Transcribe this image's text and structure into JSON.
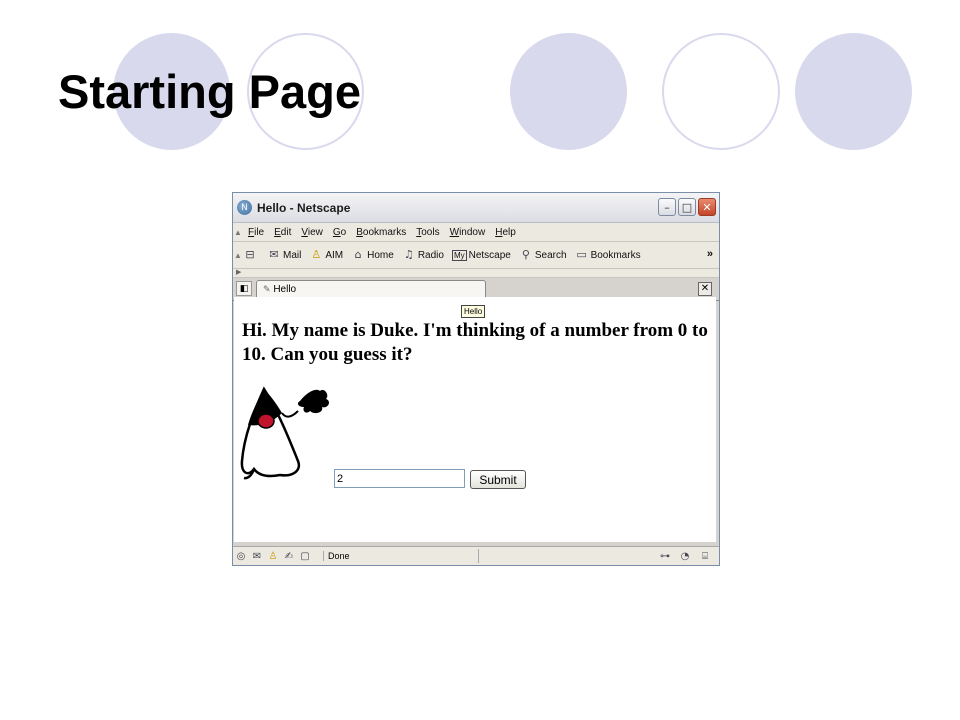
{
  "slide": {
    "title": "Starting Page"
  },
  "window": {
    "title": "Hello - Netscape",
    "controls": {
      "minimize": "–",
      "maximize": "□",
      "close": "✕"
    }
  },
  "menubar": {
    "items": [
      {
        "label_u": "F",
        "label_rest": "ile"
      },
      {
        "label_u": "E",
        "label_rest": "dit"
      },
      {
        "label_u": "V",
        "label_rest": "iew"
      },
      {
        "label_u": "G",
        "label_rest": "o"
      },
      {
        "label_u": "B",
        "label_rest": "ookmarks"
      },
      {
        "label_u": "T",
        "label_rest": "ools"
      },
      {
        "label_u": "W",
        "label_rest": "indow"
      },
      {
        "label_u": "H",
        "label_rest": "elp"
      }
    ]
  },
  "toolbar": {
    "mail": "Mail",
    "aim": "AIM",
    "home": "Home",
    "radio": "Radio",
    "my": "My",
    "netscape": "Netscape",
    "search": "Search",
    "bookmarks": "Bookmarks",
    "more": "»"
  },
  "tabs": {
    "active_label": "Hello",
    "close": "✕"
  },
  "page": {
    "tooltip": "Hello",
    "heading": "Hi. My name is Duke. I'm thinking of a number from 0 to 10. Can you guess it?",
    "input_value": "2",
    "submit_label": "Submit"
  },
  "statusbar": {
    "text": "Done"
  },
  "colors": {
    "deco": "#d9d9ee",
    "window_border": "#7a8ea8",
    "close_button": "#c4442a"
  }
}
